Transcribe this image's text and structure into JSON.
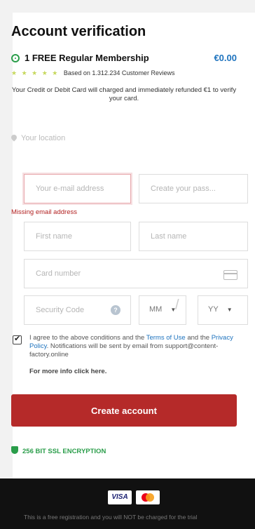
{
  "form": {
    "title": "Account verification",
    "plan": {
      "name": "1 FREE Regular Membership",
      "price": "€0.00"
    },
    "rating": {
      "stars": "★ ★ ★ ★ ★",
      "text": "Based on 1.312.234 Customer Reviews"
    },
    "notice": "Your Credit or Debit Card will charged and immediately refunded €1 to verify your card.",
    "location_placeholder": "Your location",
    "email": {
      "value": "",
      "placeholder": "Your e-mail address",
      "error": "Missing email address"
    },
    "password": {
      "placeholder": "Create your pass..."
    },
    "first_name": {
      "placeholder": "First name"
    },
    "last_name": {
      "placeholder": "Last name"
    },
    "card_number": {
      "placeholder": "Card number"
    },
    "security_code": {
      "placeholder": "Security Code",
      "help": "?"
    },
    "month": {
      "selected": "MM",
      "arrow": "▼"
    },
    "year": {
      "selected": "YY",
      "arrow": "▼"
    },
    "expiry_separator": "/",
    "agreement": {
      "text_before": "I agree to the above conditions and the ",
      "terms_link": "Terms of Use",
      "text_mid": " and the ",
      "privacy_link": "Privacy Policy",
      "text_after": ". Notifications will be sent by email from support@content-factory.online",
      "checked": true
    },
    "more_info": "For more info click here.",
    "submit_label": "Create account",
    "ssl_label": "256 BIT SSL ENCRYPTION"
  },
  "footer": {
    "visa_label": "VISA",
    "note": "This is a free registration and you will NOT be charged for the trial"
  },
  "colors": {
    "accent": "#b52a29",
    "link": "#1e73be",
    "success": "#2a9d4a",
    "error": "#b22222"
  },
  "icons": [
    "check-circle-icon",
    "location-pin-icon",
    "credit-card-icon",
    "question-icon",
    "checkbox-icon",
    "shield-icon",
    "visa-logo",
    "mastercard-logo"
  ]
}
